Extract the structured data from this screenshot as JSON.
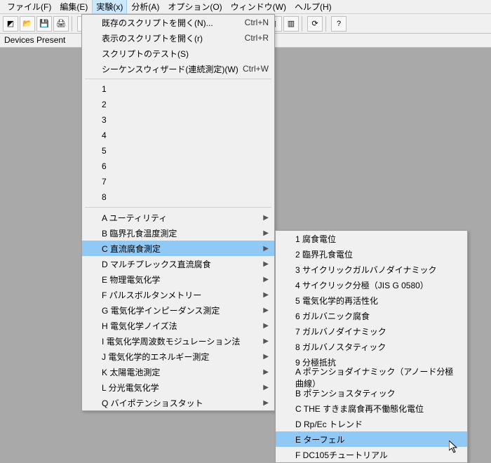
{
  "menubar": {
    "items": [
      {
        "label": "ファイル(F)"
      },
      {
        "label": "編集(E)"
      },
      {
        "label": "実験(x)"
      },
      {
        "label": "分析(A)"
      },
      {
        "label": "オプション(O)"
      },
      {
        "label": "ウィンドウ(W)"
      },
      {
        "label": "ヘルプ(H)"
      }
    ],
    "active_index": 2
  },
  "status": {
    "text": "Devices Present"
  },
  "toolbar": {
    "icons": [
      "select",
      "open",
      "save",
      "print",
      "",
      "cut",
      "copy",
      "paste",
      "",
      "chart",
      "table",
      "zoom",
      "",
      "palette",
      "marker",
      "",
      "layout1",
      "layout2",
      "layout3",
      "layout4",
      "",
      "refresh",
      "",
      "help"
    ]
  },
  "menu_main": {
    "top": [
      {
        "label": "既存のスクリプトを開く(N)...",
        "shortcut": "Ctrl+N"
      },
      {
        "label": "表示のスクリプトを開く(r)",
        "shortcut": "Ctrl+R"
      },
      {
        "label": "スクリプトのテスト(S)"
      },
      {
        "label": "シーケンスウィザード(連続測定)(W)",
        "shortcut": "Ctrl+W"
      }
    ],
    "recent": [
      "1",
      "2",
      "3",
      "4",
      "5",
      "6",
      "7",
      "8"
    ],
    "experiments": [
      {
        "label": "A ユーティリティ"
      },
      {
        "label": "B 臨界孔食温度測定"
      },
      {
        "label": "C 直流腐食測定",
        "highlight": true
      },
      {
        "label": "D マルチプレックス直流腐食"
      },
      {
        "label": "E 物理電気化学"
      },
      {
        "label": "F パルスボルタンメトリー"
      },
      {
        "label": "G 電気化学インピーダンス測定"
      },
      {
        "label": "H 電気化学ノイズ法"
      },
      {
        "label": "I 電気化学周波数モジュレーション法"
      },
      {
        "label": "J 電気化学的エネルギー測定"
      },
      {
        "label": "K 太陽電池測定"
      },
      {
        "label": "L 分光電気化学"
      },
      {
        "label": "Q バイポテンショスタット"
      }
    ]
  },
  "menu_sub": {
    "items": [
      {
        "label": "1 腐食電位"
      },
      {
        "label": "2 臨界孔食電位"
      },
      {
        "label": "3 サイクリックガルバノダイナミック"
      },
      {
        "label": "4 サイクリック分極（JIS G 0580）"
      },
      {
        "label": "5 電気化学的再活性化"
      },
      {
        "label": "6 ガルバニック腐食"
      },
      {
        "label": "7 ガルバノダイナミック"
      },
      {
        "label": "8 ガルバノスタティック"
      },
      {
        "label": "9 分極抵抗"
      },
      {
        "label": "A ポテンショダイナミック（アノード分極曲線）"
      },
      {
        "label": "B ポテンショスタティック"
      },
      {
        "label": "C THE すきま腐食再不働態化電位"
      },
      {
        "label": "D Rp/Ec トレンド"
      },
      {
        "label": "E ターフェル",
        "highlight": true
      },
      {
        "label": "F DC105チュートリアル"
      }
    ]
  }
}
